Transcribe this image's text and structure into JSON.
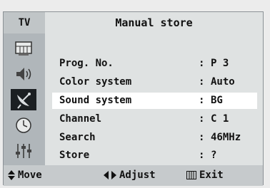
{
  "menu": {
    "tag": "TV",
    "title": "Manual store"
  },
  "sidebar": {
    "items": [
      {
        "icon": "picture-icon",
        "active": false
      },
      {
        "icon": "speaker-icon",
        "active": false
      },
      {
        "icon": "satellite-dish-icon",
        "active": true
      },
      {
        "icon": "clock-icon",
        "active": false
      },
      {
        "icon": "equalizer-icon",
        "active": false
      }
    ]
  },
  "rows": [
    {
      "label": "Prog. No.",
      "colon": ":",
      "value": "P 3",
      "selected": false
    },
    {
      "label": "Color system",
      "colon": ":",
      "value": "Auto",
      "selected": false
    },
    {
      "label": "Sound system",
      "colon": ":",
      "value": "BG",
      "selected": true
    },
    {
      "label": "Channel",
      "colon": ":",
      "value": "C 1",
      "selected": false
    },
    {
      "label": "Search",
      "colon": ":",
      "value": "46MHz",
      "selected": false
    },
    {
      "label": "Store",
      "colon": ":",
      "value": "?",
      "selected": false
    }
  ],
  "footer": {
    "move": "Move",
    "adjust": "Adjust",
    "exit": "Exit"
  },
  "colors": {
    "panel": "#dfe2e2",
    "sidebar": "#b0b6ba",
    "selected_row": "#ffffff",
    "active_icon_bg": "#1b1f22"
  }
}
